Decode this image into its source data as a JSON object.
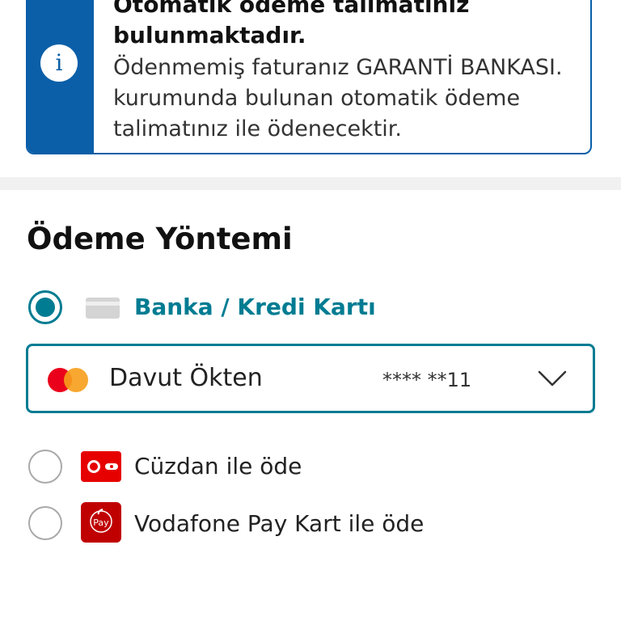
{
  "info_banner": {
    "icon": "info-icon",
    "icon_glyph": "i",
    "title_line_1": "Otomatik ödeme talimatınız",
    "title_line_2": "bulunmaktadır.",
    "body": "Ödenmemiş faturanız GARANTİ BANKASI. kurumunda bulunan otomatik ödeme talimatınız ile ödenecektir."
  },
  "payment_method": {
    "title": "Ödeme Yöntemi",
    "options": [
      {
        "label": "Banka / Kredi Kartı",
        "icon": "credit-card-icon",
        "selected": true
      },
      {
        "label": "Cüzdan ile öde",
        "icon": "wallet-icon",
        "selected": false
      },
      {
        "label": "Vodafone Pay Kart ile öde",
        "icon": "vodafone-pay-icon",
        "icon_text": "Pay",
        "selected": false
      }
    ],
    "card": {
      "brand_icon": "mastercard-icon",
      "holder": "Davut Ökten",
      "number_masked": "**** **11",
      "dropdown_icon": "chevron-down-icon"
    }
  },
  "colors": {
    "banner_blue": "#0a5fa8",
    "accent_teal": "#007c92",
    "vodafone_red": "#e60000"
  }
}
